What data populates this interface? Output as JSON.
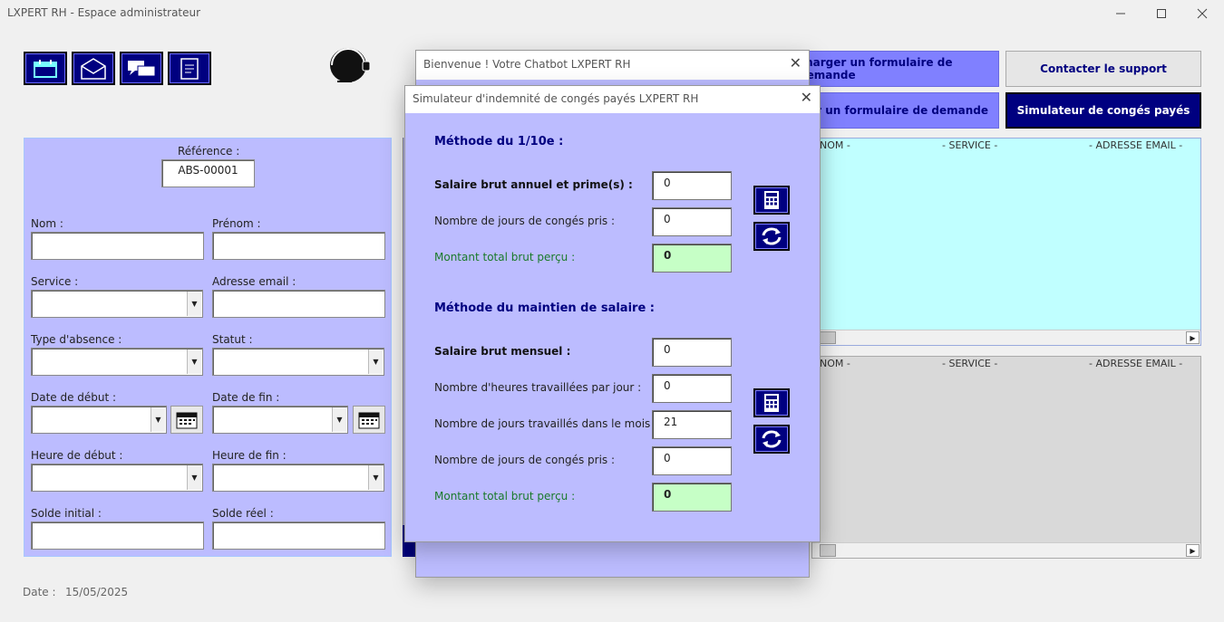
{
  "window": {
    "title": "LXPERT RH - Espace administrateur"
  },
  "toolbar": {
    "icons": [
      "calendar-icon",
      "email-icon",
      "chat-icon",
      "document-icon"
    ]
  },
  "chatbot_dialog": {
    "title": "Bienvenue ! Votre Chatbot LXPERT RH"
  },
  "top_buttons": {
    "upload_form": "charger un formulaire de demande",
    "support": "Contacter le support",
    "download_form": "er un formulaire de demande",
    "simulator": "Simulateur de congés payés"
  },
  "form": {
    "reference_label": "Référence :",
    "reference_value": "ABS-00001",
    "nom_label": "Nom :",
    "prenom_label": "Prénom :",
    "service_label": "Service :",
    "email_label": "Adresse email :",
    "type_absence_label": "Type d'absence :",
    "statut_label": "Statut :",
    "date_debut_label": "Date de début :",
    "date_fin_label": "Date de fin :",
    "heure_debut_label": "Heure de début :",
    "heure_fin_label": "Heure de fin :",
    "solde_initial_label": "Solde initial :",
    "solde_reel_label": "Solde réel :"
  },
  "footer": {
    "date_label": "Date :",
    "date_value": "15/05/2025"
  },
  "lists": {
    "top": {
      "col_nom": "NOM -",
      "col_service": "- SERVICE -",
      "col_email": "- ADRESSE EMAIL -"
    },
    "bottom": {
      "col_nom": "NOM -",
      "col_service": "- SERVICE -",
      "col_email": "- ADRESSE EMAIL -"
    }
  },
  "simulator": {
    "title": "Simulateur d'indemnité de congés payés LXPERT RH",
    "method1_title": "Méthode du 1/10e :",
    "m1_salary_label": "Salaire brut annuel et prime(s) :",
    "m1_salary_value": "0",
    "m1_days_label": "Nombre de jours de congés pris :",
    "m1_days_value": "0",
    "m1_total_label": "Montant total brut perçu :",
    "m1_total_value": "0",
    "method2_title": "Méthode du maintien de salaire :",
    "m2_salary_label": "Salaire brut mensuel :",
    "m2_salary_value": "0",
    "m2_hours_label": "Nombre d'heures travaillées par jour :",
    "m2_hours_value": "0",
    "m2_workdays_label": "Nombre de jours travaillés dans le mois :",
    "m2_workdays_value": "21",
    "m2_days_label": "Nombre de jours de congés pris :",
    "m2_days_value": "0",
    "m2_total_label": "Montant total brut perçu :",
    "m2_total_value": "0"
  }
}
